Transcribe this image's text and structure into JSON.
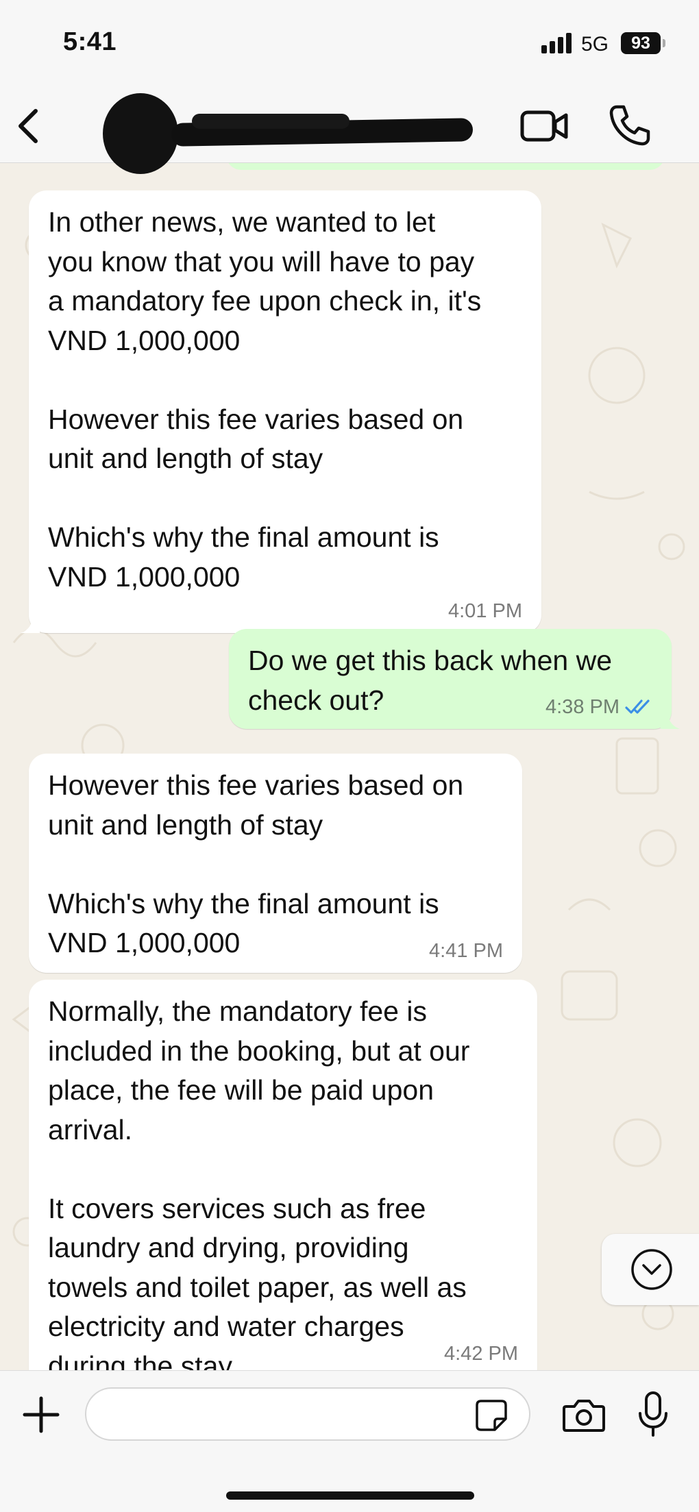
{
  "status_bar": {
    "time": "5:41",
    "network": "5G",
    "battery": "93"
  },
  "header": {
    "back_icon": "chevron-left-icon",
    "contact_name_redacted": true,
    "video_icon": "video-camera-icon",
    "call_icon": "phone-icon"
  },
  "messages": [
    {
      "direction": "incoming",
      "text": "In other news, we wanted to let\nyou know that you will have to pay\na mandatory fee upon check in, it's\nVND 1,000,000\n\nHowever this fee varies based on\nunit and length of stay\n\nWhich's why the final amount is\nVND 1,000,000",
      "time": "4:01 PM"
    },
    {
      "direction": "outgoing",
      "text": "Do we get this back when we\ncheck out?",
      "time": "4:38 PM",
      "status": "read"
    },
    {
      "direction": "incoming",
      "text": "However this fee varies based on\nunit and length of stay\n\nWhich's why the final amount is\nVND 1,000,000",
      "time": "4:41 PM"
    },
    {
      "direction": "incoming",
      "text": "Normally, the mandatory fee is\nincluded in the booking, but at our\nplace, the fee will be paid upon\narrival.\n\nIt covers services such as free\nlaundry and drying, providing\ntowels and toilet paper, as well as\nelectricity and water charges\nduring the stay.",
      "time": "4:42 PM"
    }
  ],
  "composer": {
    "input_value": "",
    "plus_icon": "plus-icon",
    "sticker_icon": "sticker-icon",
    "camera_icon": "camera-icon",
    "mic_icon": "microphone-icon"
  },
  "colors": {
    "incoming_bubble": "#ffffff",
    "outgoing_bubble": "#d9fdd3",
    "chat_background": "#f3efe7",
    "read_receipt": "#3b8fe6"
  }
}
